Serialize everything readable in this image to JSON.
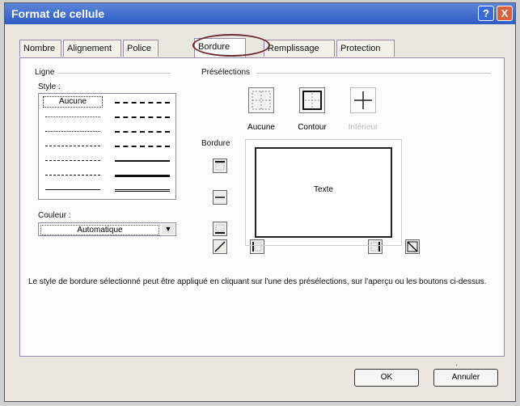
{
  "window": {
    "title": "Format de cellule"
  },
  "title_buttons": {
    "help": "?",
    "close": "X"
  },
  "tabs": [
    {
      "label": "Nombre"
    },
    {
      "label": "Alignement"
    },
    {
      "label": "Police"
    },
    {
      "label": "Bordure"
    },
    {
      "label": "Remplissage"
    },
    {
      "label": "Protection"
    }
  ],
  "line": {
    "group_label": "Ligne",
    "style_label": "Style :",
    "none_label": "Aucune",
    "color_label": "Couleur :",
    "color_value": "Automatique"
  },
  "presets": {
    "group_label": "Présélections",
    "items": [
      {
        "label": "Aucune"
      },
      {
        "label": "Contour"
      },
      {
        "label": "Intérieur"
      }
    ]
  },
  "border": {
    "group_label": "Bordure",
    "preview_text": "Texte"
  },
  "info_text": "Le style de bordure sélectionné peut être appliqué en cliquant sur l'une des présélections, sur l'aperçu ou les boutons ci-dessus.",
  "buttons": {
    "ok": "OK",
    "cancel": "Annuler"
  }
}
